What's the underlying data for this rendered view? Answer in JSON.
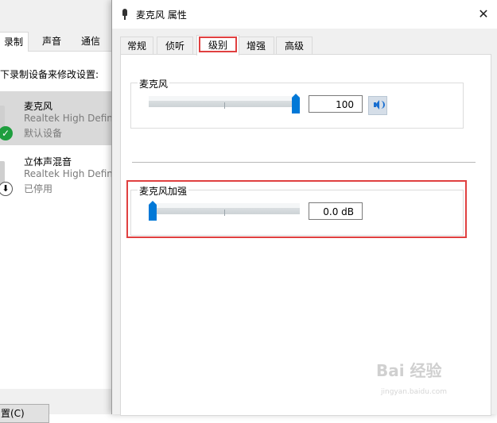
{
  "background_dialog": {
    "tabs": [
      "录制",
      "声音",
      "通信"
    ],
    "instruction": "下录制设备来修改设置:",
    "devices": [
      {
        "name": "麦克风",
        "driver": "Realtek High Defin",
        "status": "默认设备"
      },
      {
        "name": "立体声混音",
        "driver": "Realtek High Defin",
        "status": "已停用"
      }
    ],
    "bottom_button": "置(C)"
  },
  "properties_dialog": {
    "title": "麦克风 属性",
    "close_glyph": "✕",
    "tabs": [
      "常规",
      "侦听",
      "级别",
      "增强",
      "高级"
    ],
    "active_tab": "级别",
    "microphone": {
      "label": "麦克风",
      "value_text": "100",
      "level": 1.0,
      "mute_icon": "speaker-icon"
    },
    "boost": {
      "label": "麦克风加强",
      "value_text": "0.0 dB",
      "level": 0.0
    }
  },
  "watermark": {
    "brand": "Bai  经验",
    "url": "jingyan.baidu.com"
  },
  "colors": {
    "accent": "#0078d7",
    "highlight_box": "#e04040",
    "ok_status": "#1e9e3e"
  }
}
